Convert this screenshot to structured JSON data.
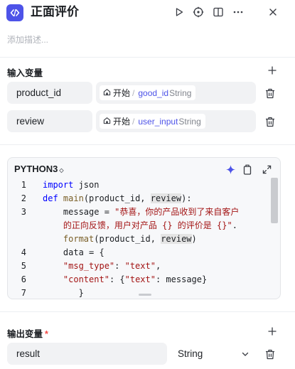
{
  "header": {
    "title": "正面评价",
    "description_placeholder": "添加描述..."
  },
  "input_section": {
    "title": "输入变量",
    "rows": [
      {
        "name": "product_id",
        "source": "开始",
        "separator": "/",
        "variable": "good_id",
        "type": "String"
      },
      {
        "name": "review",
        "source": "开始",
        "separator": "/",
        "variable": "user_input",
        "type": "String"
      }
    ]
  },
  "code_editor": {
    "language": "PYTHON3",
    "language_caret": "◇",
    "line_numbers": [
      "1",
      "2",
      "3",
      "",
      "4",
      "5",
      "6",
      "7"
    ]
  },
  "output_section": {
    "title": "输出变量",
    "required_mark": "*",
    "rows": [
      {
        "name": "result",
        "type": "String"
      }
    ]
  },
  "icons": {
    "app": "code-icon",
    "run": "play-icon",
    "debug": "target-icon",
    "panel": "split-panel-icon",
    "more": "more-icon",
    "close": "close-icon",
    "add": "plus-icon",
    "delete": "trash-icon",
    "ai": "sparkle-icon",
    "copy": "copy-icon",
    "expand": "expand-icon",
    "dropdown": "chevron-down-icon",
    "home": "home-icon"
  },
  "colors": {
    "accent": "#4d53e8",
    "required": "#f54a45",
    "keyword": "#0000ff",
    "string": "#a31515"
  }
}
